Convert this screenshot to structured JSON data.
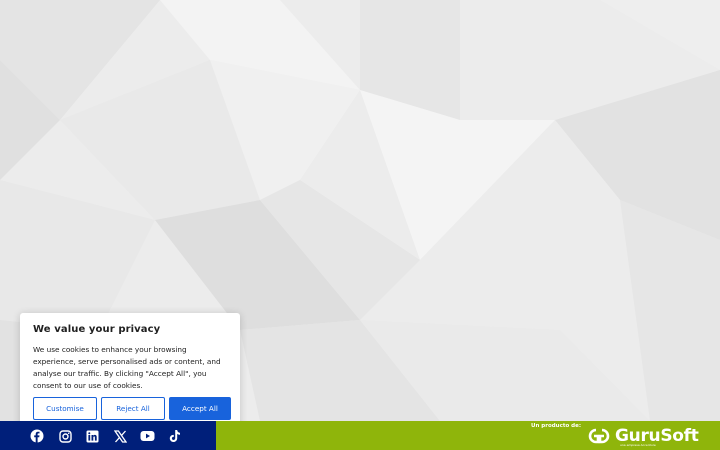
{
  "cookie_banner": {
    "title": "We value your privacy",
    "body": "We use cookies to enhance your browsing experience, serve personalised ads or content, and analyse our traffic. By clicking \"Accept All\", you consent to our use of cookies.",
    "customise_label": "Customise",
    "reject_label": "Reject All",
    "accept_label": "Accept All"
  },
  "footer": {
    "social_icons": [
      "facebook-icon",
      "instagram-icon",
      "linkedin-icon",
      "x-icon",
      "youtube-icon",
      "tiktok-icon"
    ],
    "producto_label": "Un producto de:",
    "brand_name": "GuruSoft",
    "brand_tagline": "una empresa Accenture"
  },
  "colors": {
    "footer_left": "#001f7a",
    "footer_right": "#8fb50b",
    "accent": "#1863dc"
  }
}
